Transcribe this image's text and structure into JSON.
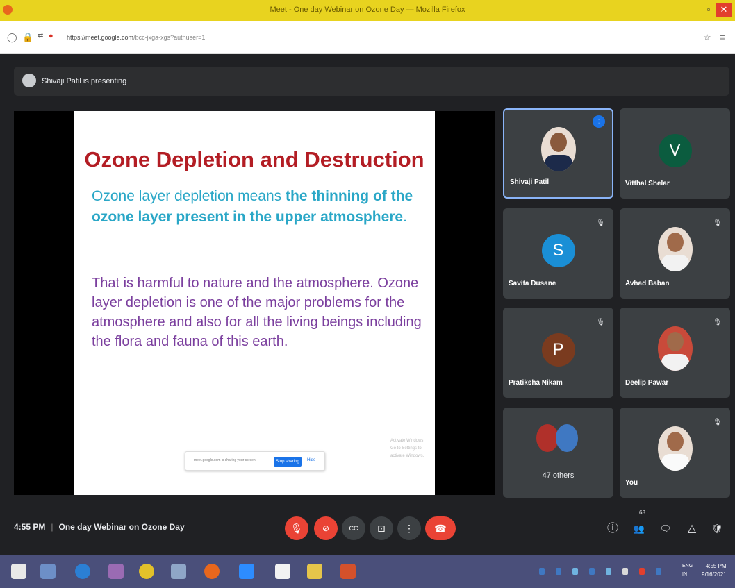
{
  "browser": {
    "title": "Meet - One day Webinar on Ozone Day — Mozilla Firefox",
    "url_domain": "https://meet.google.com",
    "url_path": "/bcc-jxga-xgs?authuser=1",
    "min_glyph": "–",
    "max_glyph": "▫",
    "close_glyph": "✕"
  },
  "meet": {
    "presenting_text": "Shivaji Patil is presenting",
    "time": "4:55 PM",
    "meeting_name": "One day Webinar on Ozone Day"
  },
  "slide": {
    "title": "Ozone Depletion and Destruction",
    "p1_plain": "Ozone layer depletion means ",
    "p1_bold": "the thinning of the ozone layer present in the upper atmosphere",
    "p1_end": ".",
    "p2": "That is harmful to nature and the atmosphere. Ozone layer depletion is one of the major problems for the atmosphere and also for all the living beings including the flora and fauna of this earth.",
    "share_banner_text": "meet.google.com is sharing your screen.",
    "share_stop_label": "Stop sharing",
    "share_hide_label": "Hide",
    "watermark_line1": "Activate Windows",
    "watermark_line2": "Go to Settings to activate Windows."
  },
  "participants": [
    {
      "name": "Shivaji Patil",
      "type": "photo",
      "active": true
    },
    {
      "name": "Vitthal Shelar",
      "type": "initial",
      "initial": "V",
      "color": "#0b5c3f"
    },
    {
      "name": "Savita Dusane",
      "type": "initial",
      "initial": "S",
      "color": "#1a8fd6"
    },
    {
      "name": "Avhad Baban",
      "type": "photo"
    },
    {
      "name": "Pratiksha Nikam",
      "type": "initial",
      "initial": "P",
      "color": "#7a3b1f"
    },
    {
      "name": "Deelip Pawar",
      "type": "photo"
    },
    {
      "name": "47 others",
      "type": "others"
    },
    {
      "name": "You",
      "type": "photo"
    }
  ],
  "icons": {
    "mute": "🎙",
    "speaking": "⫶",
    "mic_off": "🎙",
    "cam_off": "⊘",
    "captions": "CC",
    "present": "⊡",
    "more": "⋮",
    "end_call": "☎",
    "info": "ⓘ",
    "people": "👥",
    "chat": "🗨",
    "activities": "△",
    "host": "🛡"
  },
  "people_count": "68",
  "taskbar": {
    "time": "4:55 PM",
    "date": "9/16/2021",
    "lang1": "ENG",
    "lang2": "IN"
  }
}
